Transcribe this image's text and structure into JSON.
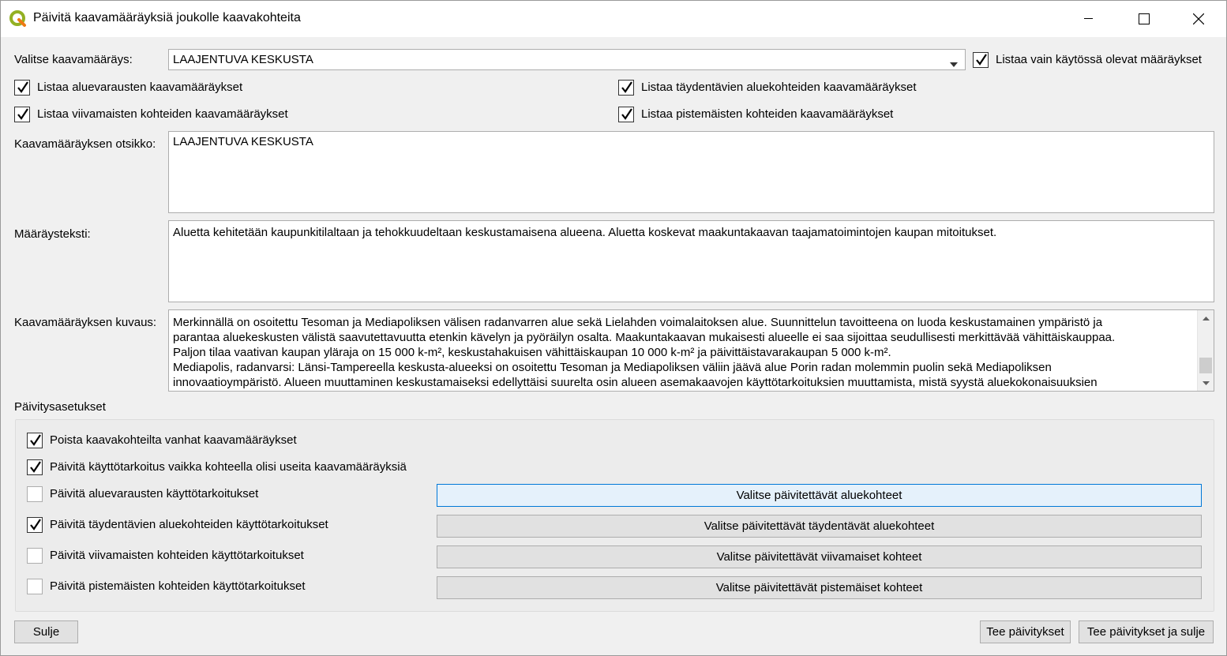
{
  "window": {
    "title": "Päivitä kaavamääräyksiä joukolle kaavakohteita",
    "icon": "qgis-logo-icon"
  },
  "selection": {
    "label": "Valitse kaavamääräys:",
    "selected": "LAAJENTUVA KESKUSTA",
    "only_in_use_label": "Listaa vain käytössä olevat määräykset",
    "only_in_use_checked": true
  },
  "filters": {
    "area_reservations": {
      "label": "Listaa aluevarausten kaavamääräykset",
      "checked": true
    },
    "supplementary_areas": {
      "label": "Listaa täydentävien aluekohteiden kaavamääräykset",
      "checked": true
    },
    "line_features": {
      "label": "Listaa viivamaisten kohteiden kaavamääräykset",
      "checked": true
    },
    "point_features": {
      "label": "Listaa pistemäisten kohteiden kaavamääräykset",
      "checked": true
    }
  },
  "title_field": {
    "label": "Kaavamääräyksen otsikko:",
    "value": "LAAJENTUVA KESKUSTA"
  },
  "regulation_text": {
    "label": "Määräysteksti:",
    "value": "Aluetta kehitetään kaupunkitilaltaan ja tehokkuudeltaan keskustamaisena alueena. Aluetta koskevat maakuntakaavan taajamatoimintojen kaupan mitoitukset."
  },
  "description": {
    "label": "Kaavamääräyksen kuvaus:",
    "lines": [
      "Merkinnällä on osoitettu Tesoman ja Mediapoliksen välisen radanvarren alue sekä Lielahden voimalaitoksen alue. Suunnittelun tavoitteena on luoda keskustamainen ympäristö ja",
      "parantaa aluekeskusten välistä saavutettavuutta etenkin kävelyn ja pyöräilyn osalta. Maakuntakaavan mukaisesti alueelle ei saa sijoittaa seudullisesti merkittävää vähittäiskauppaa.",
      "Paljon tilaa vaativan kaupan yläraja on 15 000 k-m², keskustahakuisen vähittäiskaupan 10 000 k-m² ja päivittäistavarakaupan 5 000 k-m².",
      "Mediapolis, radanvarsi: Länsi-Tampereella keskusta-alueeksi on osoitettu Tesoman ja Mediapoliksen väliin jäävä alue Porin radan molemmin puolin sekä Mediapoliksen",
      "innovaatioympäristö. Alueen muuttaminen keskustamaiseksi edellyttäisi suurelta osin alueen asemakaavojen käyttötarkoituksien muuttamista, mistä syystä aluekokonaisuuksien"
    ]
  },
  "update_settings": {
    "heading": "Päivitysasetukset",
    "remove_old": {
      "label": "Poista kaavakohteilta vanhat kaavamääräykset",
      "checked": true
    },
    "update_usage_multi": {
      "label": "Päivitä käyttötarkoitus vaikka kohteella olisi useita kaavamääräyksiä",
      "checked": true
    },
    "update_area_reservations": {
      "label": "Päivitä aluevarausten käyttötarkoitukset",
      "checked": false,
      "button": "Valitse päivitettävät aluekohteet"
    },
    "update_supplementary": {
      "label": "Päivitä täydentävien aluekohteiden käyttötarkoitukset",
      "checked": true,
      "button": "Valitse päivitettävät täydentävät aluekohteet"
    },
    "update_lines": {
      "label": "Päivitä viivamaisten kohteiden käyttötarkoitukset",
      "checked": false,
      "button": "Valitse päivitettävät viivamaiset kohteet"
    },
    "update_points": {
      "label": "Päivitä pistemäisten kohteiden käyttötarkoitukset",
      "checked": false,
      "button": "Valitse päivitettävät pistemäiset kohteet"
    }
  },
  "footer": {
    "close": "Sulje",
    "apply": "Tee päivitykset",
    "apply_close": "Tee päivitykset ja sulje"
  }
}
